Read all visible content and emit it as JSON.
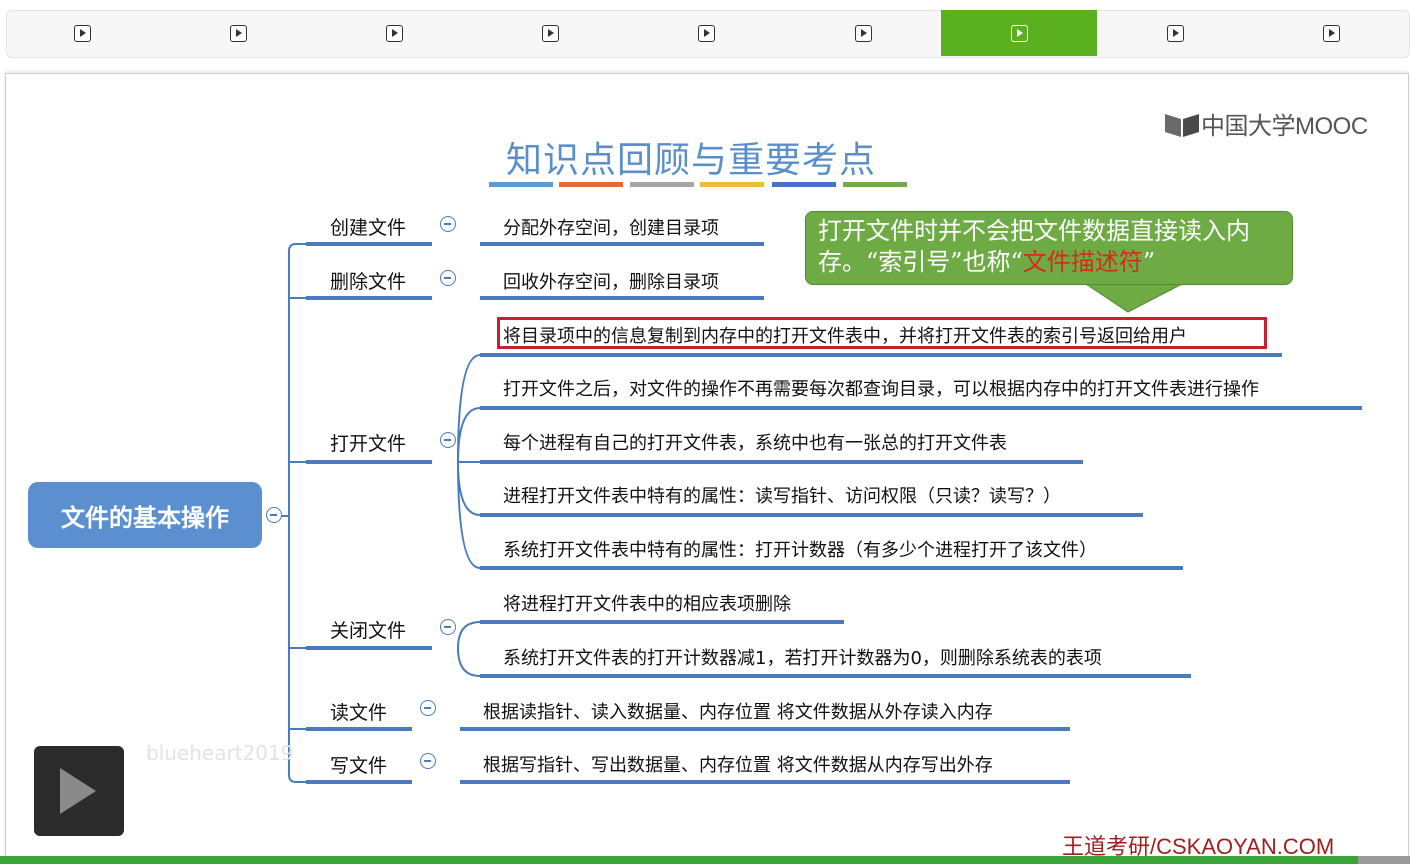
{
  "tabs": [
    {
      "label": ""
    },
    {
      "label": ""
    },
    {
      "label": ""
    },
    {
      "label": ""
    },
    {
      "label": ""
    },
    {
      "label": ""
    },
    {
      "label": "",
      "active": true
    },
    {
      "label": ""
    },
    {
      "label": ""
    }
  ],
  "slide": {
    "title": "知识点回顾与重要考点",
    "title_line_colors": [
      "#5b9bd5",
      "#e06a3b",
      "#a5a5a5",
      "#f0b93a",
      "#4472c4",
      "#70ad47"
    ],
    "logo_text": "中国大学MOOC",
    "root": "文件的基本操作",
    "branches": {
      "create": {
        "label": "创建文件",
        "items": [
          "分配外存空间，创建目录项"
        ]
      },
      "delete": {
        "label": "删除文件",
        "items": [
          "回收外存空间，删除目录项"
        ]
      },
      "open": {
        "label": "打开文件",
        "items": [
          "将目录项中的信息复制到内存中的打开文件表中，并将打开文件表的索引号返回给用户",
          "打开文件之后，对文件的操作不再需要每次都查询目录，可以根据内存中的打开文件表进行操作",
          "每个进程有自己的打开文件表，系统中也有一张总的打开文件表",
          "进程打开文件表中特有的属性：读写指针、访问权限（只读？读写？）",
          "系统打开文件表中特有的属性：打开计数器（有多少个进程打开了该文件）"
        ]
      },
      "close": {
        "label": "关闭文件",
        "items": [
          "将进程打开文件表中的相应表项删除",
          "系统打开文件表的打开计数器减1，若打开计数器为0，则删除系统表的表项"
        ]
      },
      "read": {
        "label": "读文件",
        "items": [
          "根据读指针、读入数据量、内存位置 将文件数据从外存读入内存"
        ]
      },
      "write": {
        "label": "写文件",
        "items": [
          "根据写指针、写出数据量、内存位置 将文件数据从内存写出外存"
        ]
      }
    },
    "callout": {
      "text1": "打开文件时并不会把文件数据直接读入内存。“索引号”也称“",
      "highlight": "文件描述符",
      "text2": "”",
      "highlight_color": "#d62a1e"
    },
    "watermark": "blueheart2019",
    "credit": "王道考研/CSKAOYAN.COM"
  },
  "colors": {
    "accent": "#5ab01e",
    "branch_line": "#4a7bbd",
    "root_bg": "#5b8fd0",
    "callout_bg": "#6fab45",
    "highlight_box": "#c8202e"
  }
}
